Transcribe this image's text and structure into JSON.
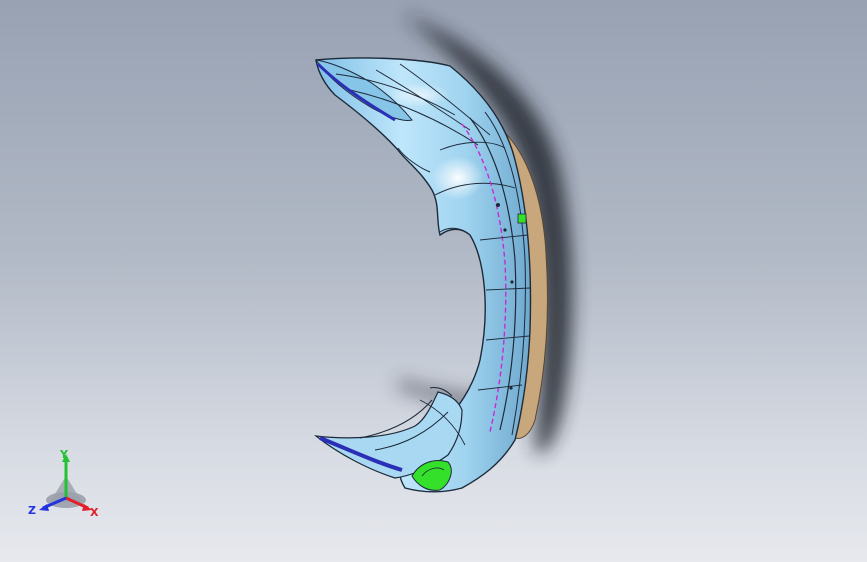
{
  "viewport": {
    "background_top": "#98a2b3",
    "background_bottom": "#e7e9ee"
  },
  "model": {
    "surface_color": "#9fd3ef",
    "edge_color": "#1d2a3a",
    "inner_color": "#c8a77c",
    "shadow_color": "#2a2f3a",
    "highlight_green": "#35e02a",
    "accent_magenta": "#c42bd6",
    "accent_blue": "#2b2fb5"
  },
  "triad": {
    "x_label": "X",
    "y_label": "Y",
    "z_label": "Z",
    "x_color": "#e0202a",
    "y_color": "#22c233",
    "z_color": "#2233e0"
  }
}
